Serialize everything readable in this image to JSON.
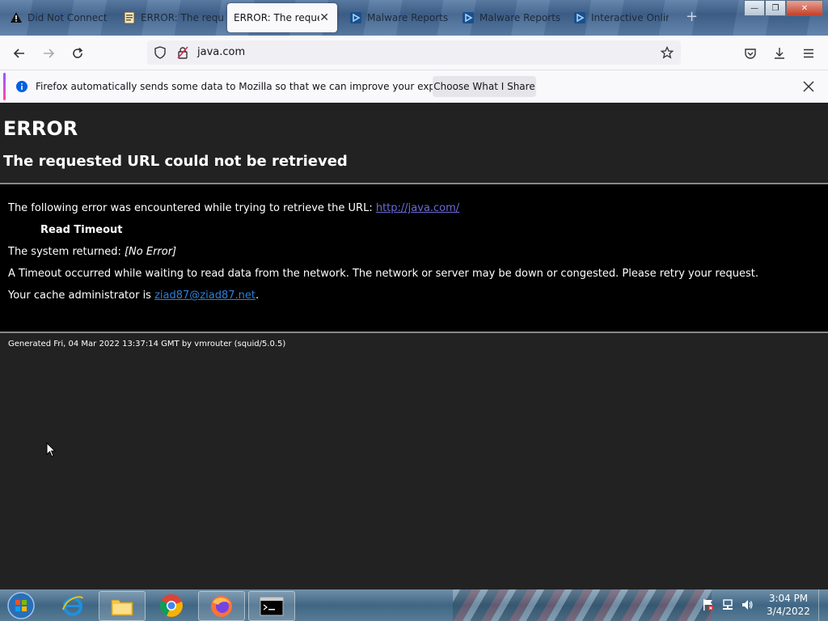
{
  "tabs": [
    {
      "label": "Did Not Connect",
      "icon": "warning-icon"
    },
    {
      "label": "ERROR: The requ",
      "icon": "page-icon"
    },
    {
      "label": "ERROR: The request",
      "icon": "none",
      "active": true
    },
    {
      "label": "Malware Reports",
      "icon": "anyrun-icon"
    },
    {
      "label": "Malware Reports",
      "icon": "anyrun-icon"
    },
    {
      "label": "Interactive Onlin",
      "icon": "anyrun-icon"
    }
  ],
  "window": {
    "minimize": "—",
    "restore": "❐",
    "close": "✕"
  },
  "address": {
    "url": "java.com"
  },
  "notification": {
    "text": "Firefox automatically sends some data to Mozilla so that we can improve your experience.",
    "button": "Choose What I Share"
  },
  "page": {
    "title": "ERROR",
    "subtitle": "The requested URL could not be retrieved",
    "intro": "The following error was encountered while trying to retrieve the URL:",
    "url_link": "http://java.com/",
    "error_name": "Read Timeout",
    "system_returned_label": "The system returned:",
    "system_returned_value": "[No Error]",
    "description": "A Timeout occurred while waiting to read data from the network. The network or server may be down or congested. Please retry your request.",
    "admin_label": "Your cache administrator is",
    "admin_email": "ziad87@ziad87.net",
    "admin_suffix": ".",
    "footer": "Generated Fri, 04 Mar 2022 13:37:14 GMT by vmrouter (squid/5.0.5)"
  },
  "taskbar": {
    "items": [
      "start-orb",
      "internet-explorer",
      "file-explorer",
      "chrome",
      "firefox",
      "command-prompt"
    ],
    "time": "3:04 PM",
    "date": "3/4/2022"
  },
  "colors": {
    "accent": "#0060df",
    "link": "#6b6bd6",
    "page_bg": "#222222"
  }
}
